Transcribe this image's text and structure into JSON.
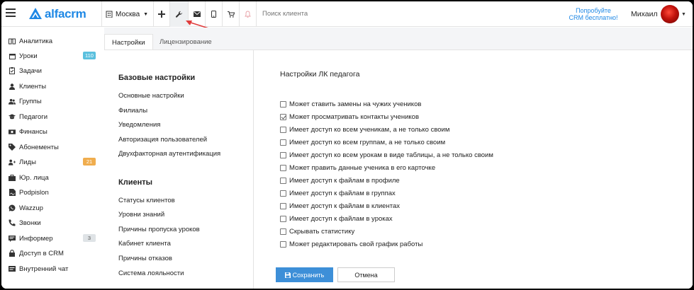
{
  "brand": {
    "logo_text": "alfacrm",
    "color": "#1e88e5"
  },
  "topbar": {
    "city": "Москва",
    "search_placeholder": "Поиск клиента",
    "promo_line1": "Попробуйте",
    "promo_line2": "CRM бесплатно!",
    "user_name": "Михаил"
  },
  "sidebar": {
    "items": [
      {
        "label": "Аналитика",
        "icon": "analytics-icon"
      },
      {
        "label": "Уроки",
        "icon": "calendar-icon",
        "badge": "110",
        "badge_color": "#5bc0de"
      },
      {
        "label": "Задачи",
        "icon": "tasks-icon"
      },
      {
        "label": "Клиенты",
        "icon": "user-icon"
      },
      {
        "label": "Группы",
        "icon": "users-icon"
      },
      {
        "label": "Педагоги",
        "icon": "graduation-cap-icon"
      },
      {
        "label": "Финансы",
        "icon": "money-icon"
      },
      {
        "label": "Абонементы",
        "icon": "tag-icon"
      },
      {
        "label": "Лиды",
        "icon": "funnel-icon",
        "badge": "21",
        "badge_color": "#f0ad4e"
      },
      {
        "label": "Юр. лица",
        "icon": "briefcase-icon"
      },
      {
        "label": "Podpislon",
        "icon": "document-icon"
      },
      {
        "label": "Wazzup",
        "icon": "whatsapp-icon"
      },
      {
        "label": "Звонки",
        "icon": "phone-icon"
      },
      {
        "label": "Информер",
        "icon": "informer-icon",
        "badge": "3",
        "badge_color": "#dfe3e6"
      },
      {
        "label": "Доступ в CRM",
        "icon": "lock-icon"
      },
      {
        "label": "Внутренний чат",
        "icon": "chat-icon"
      }
    ]
  },
  "tabs": [
    {
      "label": "Настройки",
      "active": true
    },
    {
      "label": "Лицензирование",
      "active": false
    }
  ],
  "settings_menu": {
    "base_title": "Базовые настройки",
    "base_links": [
      "Основные настройки",
      "Филиалы",
      "Уведомления",
      "Авторизация пользователей",
      "Двухфакторная аутентификация"
    ],
    "clients_title": "Клиенты",
    "client_links": [
      "Статусы клиентов",
      "Уровни знаний",
      "Причины пропуска уроков",
      "Кабинет клиента",
      "Причины отказов",
      "Система лояльности"
    ]
  },
  "teacher_settings": {
    "title": "Настройки ЛК педагога",
    "options": [
      {
        "label": "Может ставить замены на чужих учеников",
        "checked": false
      },
      {
        "label": "Может просматривать контакты учеников",
        "checked": true
      },
      {
        "label": "Имеет доступ ко всем ученикам, а не только своим",
        "checked": false
      },
      {
        "label": "Имеет доступ ко всем группам, а не только своим",
        "checked": false
      },
      {
        "label": "Имеет доступ ко всем урокам в виде таблицы, а не только своим",
        "checked": false
      },
      {
        "label": "Может править данные ученика в его карточке",
        "checked": false
      },
      {
        "label": "Имеет доступ к файлам в профиле",
        "checked": false
      },
      {
        "label": "Имеет доступ к файлам в группах",
        "checked": false
      },
      {
        "label": "Имеет доступ к файлам в клиентах",
        "checked": false
      },
      {
        "label": "Имеет доступ к файлам в уроках",
        "checked": false
      },
      {
        "label": "Скрывать статистику",
        "checked": false
      },
      {
        "label": "Может редактировать свой график работы",
        "checked": false
      }
    ],
    "save_label": "Сохранить",
    "cancel_label": "Отмена"
  },
  "colors": {
    "accent": "#3d8fd8",
    "annotation_arrow": "#e03c3c"
  }
}
